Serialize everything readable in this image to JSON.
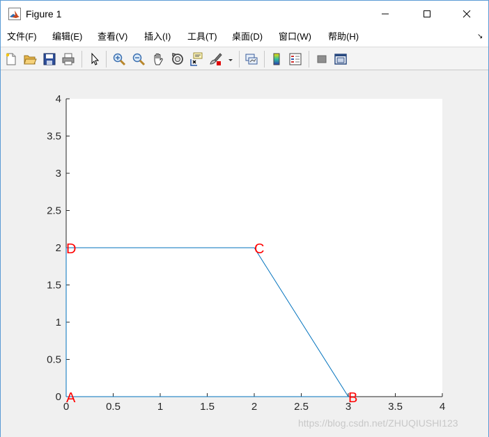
{
  "window": {
    "title": "Figure 1"
  },
  "menu": {
    "items": [
      "文件(F)",
      "编辑(E)",
      "查看(V)",
      "插入(I)",
      "工具(T)",
      "桌面(D)",
      "窗口(W)",
      "帮助(H)"
    ],
    "overflow": "↘"
  },
  "toolbar": {
    "buttons": [
      "new-figure-icon",
      "open-file-icon",
      "save-icon",
      "print-icon",
      "pointer-icon",
      "zoom-in-icon",
      "zoom-out-icon",
      "pan-hand-icon",
      "rotate-3d-icon",
      "data-cursor-icon",
      "brush-icon",
      "brush-dropdown-icon",
      "link-plot-icon",
      "colorbar-icon",
      "legend-icon",
      "hide-plot-tools-icon",
      "show-plot-tools-icon"
    ]
  },
  "chart_data": {
    "type": "line",
    "x": [
      0,
      3,
      2,
      0,
      0
    ],
    "y": [
      0,
      0,
      2,
      2,
      0
    ],
    "xlim": [
      0,
      4
    ],
    "ylim": [
      0,
      4
    ],
    "xticks": [
      "0",
      "0.5",
      "1",
      "1.5",
      "2",
      "2.5",
      "3",
      "3.5",
      "4"
    ],
    "yticks": [
      "0",
      "0.5",
      "1",
      "1.5",
      "2",
      "2.5",
      "3",
      "3.5",
      "4"
    ],
    "grid": false,
    "line_color": "#0072bd",
    "annotations": [
      {
        "text": "A",
        "x": 0,
        "y": 0
      },
      {
        "text": "B",
        "x": 3,
        "y": 0
      },
      {
        "text": "C",
        "x": 2,
        "y": 2
      },
      {
        "text": "D",
        "x": 0,
        "y": 2
      }
    ],
    "annotation_color": "#ff0000"
  },
  "watermark": "https://blog.csdn.net/ZHUQIUSHI123"
}
